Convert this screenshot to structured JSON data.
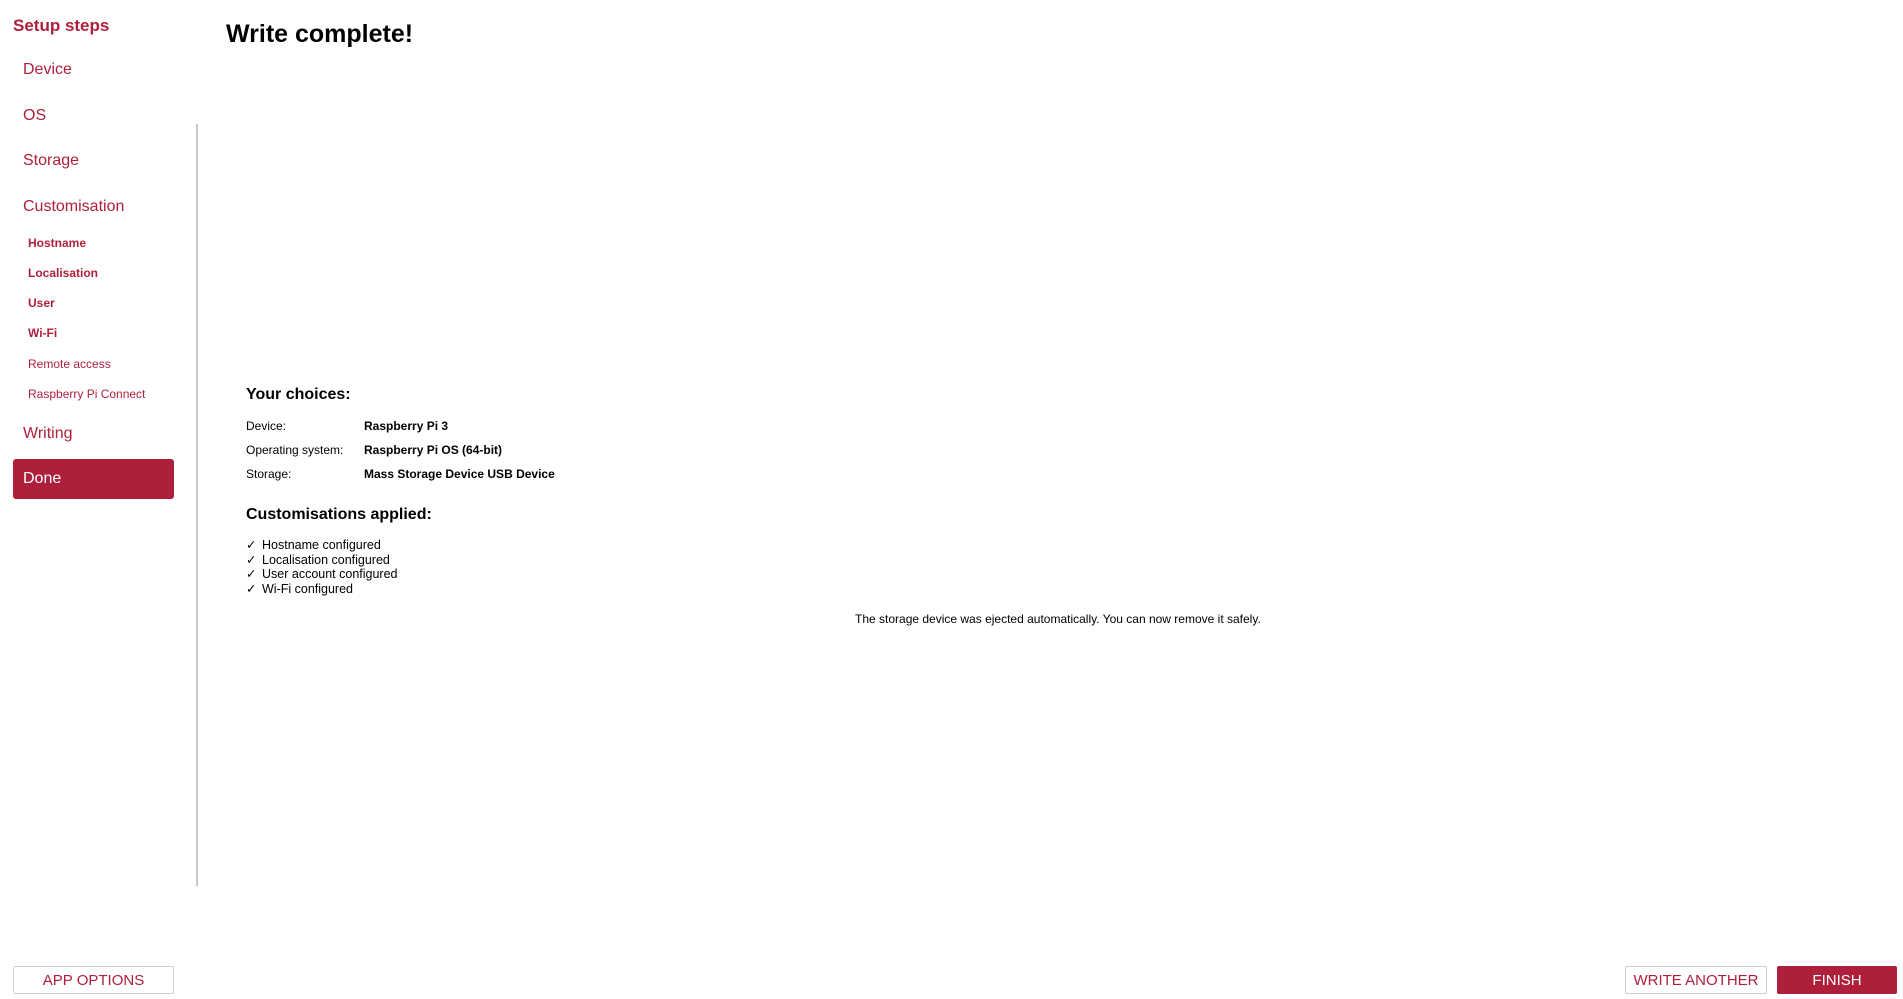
{
  "sidebar": {
    "title": "Setup steps",
    "items": [
      {
        "label": "Device"
      },
      {
        "label": "OS"
      },
      {
        "label": "Storage"
      },
      {
        "label": "Customisation"
      },
      {
        "label": "Writing"
      },
      {
        "label": "Done"
      }
    ],
    "sub_items": [
      {
        "label": "Hostname"
      },
      {
        "label": "Localisation"
      },
      {
        "label": "User"
      },
      {
        "label": "Wi-Fi"
      },
      {
        "label": "Remote access"
      },
      {
        "label": "Raspberry Pi Connect"
      }
    ],
    "active_item": "Done",
    "accent_color": "#ae1f3b"
  },
  "main": {
    "title": "Write complete!",
    "choices_heading": "Your choices:",
    "choices": [
      {
        "label": "Device:",
        "value": "Raspberry Pi 3"
      },
      {
        "label": "Operating system:",
        "value": "Raspberry Pi OS (64-bit)"
      },
      {
        "label": "Storage:",
        "value": "Mass Storage Device USB Device"
      }
    ],
    "customisations_heading": "Customisations applied:",
    "check_glyph": "✓",
    "customisations": [
      "Hostname configured",
      "Localisation configured",
      "User account configured",
      "Wi-Fi configured"
    ],
    "eject_message": "The storage device was ejected automatically. You can now remove it safely."
  },
  "footer": {
    "app_options_label": "APP OPTIONS",
    "write_another_label": "WRITE ANOTHER",
    "finish_label": "FINISH"
  }
}
